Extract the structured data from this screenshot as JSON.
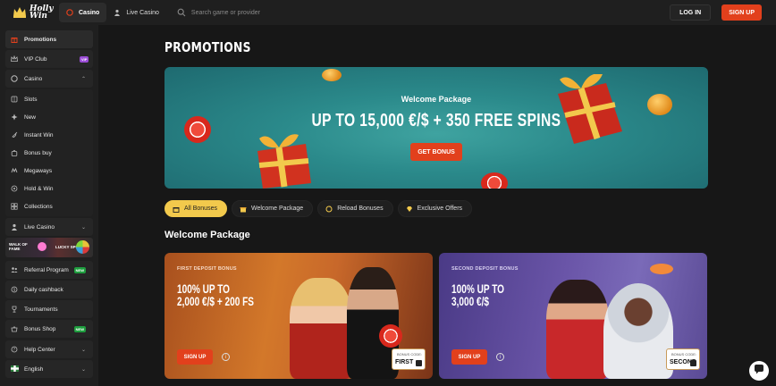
{
  "header": {
    "logo_text_line1": "Holly",
    "logo_text_line2": "Win",
    "tabs": [
      {
        "label": "Casino",
        "icon": "casino-icon",
        "active": true
      },
      {
        "label": "Live Casino",
        "icon": "live-casino-icon",
        "active": false
      }
    ],
    "search_placeholder": "Search game or provider",
    "login_label": "LOG IN",
    "signup_label": "SIGN UP"
  },
  "sidebar": {
    "items": [
      {
        "label": "Promotions",
        "icon": "gift-icon"
      },
      {
        "label": "VIP Club",
        "icon": "crown-icon",
        "badge": "VIP"
      },
      {
        "label": "Casino",
        "icon": "casino-icon"
      },
      {
        "label": "Slots",
        "icon": "slots-icon"
      },
      {
        "label": "New",
        "icon": "sparkle-icon"
      },
      {
        "label": "Instant Win",
        "icon": "rocket-icon"
      },
      {
        "label": "Bonus buy",
        "icon": "bag-icon"
      },
      {
        "label": "Megaways",
        "icon": "megaways-icon"
      },
      {
        "label": "Hold & Win",
        "icon": "hold-win-icon"
      },
      {
        "label": "Collections",
        "icon": "collections-icon"
      },
      {
        "label": "Live Casino",
        "icon": "live-casino-icon"
      },
      {
        "label": "Referral Program",
        "icon": "referral-icon",
        "badge": "NEW"
      },
      {
        "label": "Daily cashback",
        "icon": "cashback-icon"
      },
      {
        "label": "Tournaments",
        "icon": "trophy-icon"
      },
      {
        "label": "Bonus Shop",
        "icon": "shop-icon",
        "badge": "NEW"
      },
      {
        "label": "Help Center",
        "icon": "help-icon"
      },
      {
        "label": "English",
        "icon": "flag-icon"
      }
    ],
    "promo_strip": {
      "left": "WALK OF\nFAME",
      "right": "LUCKY SPIN"
    }
  },
  "main": {
    "page_title": "PROMOTIONS",
    "hero": {
      "subtitle": "Welcome Package",
      "title": "UP TO 15,000 €/$ + 350 FREE SPINS",
      "button": "GET BONUS"
    },
    "filters": [
      {
        "label": "All Bonuses",
        "icon": "all-bonuses-icon",
        "active": true
      },
      {
        "label": "Welcome Package",
        "icon": "welcome-icon",
        "active": false
      },
      {
        "label": "Reload Bonuses",
        "icon": "reload-icon",
        "active": false
      },
      {
        "label": "Exclusive Offers",
        "icon": "diamond-icon",
        "active": false
      }
    ],
    "section_title": "Welcome Package",
    "cards": [
      {
        "kicker": "FIRST DEPOSIT BONUS",
        "title_line1": "100% UP TO",
        "title_line2": "2,000 €/$ + 200 FS",
        "button": "SIGN UP",
        "code_label": "BONUS CODE:",
        "code": "FIRST"
      },
      {
        "kicker": "SECOND DEPOSIT BONUS",
        "title_line1": "100% UP TO",
        "title_line2": "3,000 €/$",
        "button": "SIGN UP",
        "code_label": "BONUS CODE:",
        "code": "SECOND"
      }
    ]
  },
  "colors": {
    "accent": "#e2401c",
    "filter_active": "#f2c94c",
    "hero_bg": "#2b8a8b",
    "card1": "#d3782a",
    "card2": "#6a55a8"
  }
}
